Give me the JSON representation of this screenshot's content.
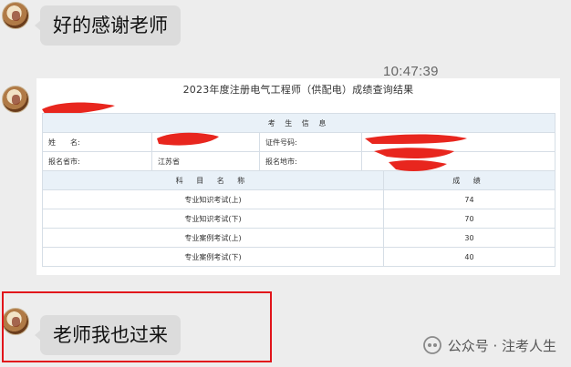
{
  "messages": [
    {
      "text": "好的感谢老师"
    },
    {
      "text": "老师我也过来"
    }
  ],
  "timestamp": "10:47:39",
  "result": {
    "title": "2023年度注册电气工程师（供配电）成绩查询结果",
    "section_title": "考 生 信 息",
    "name_label": "姓　　名:",
    "id_label": "证件号码:",
    "province_label": "报名省市:",
    "province_value": "江苏省",
    "city_label": "报名地市:",
    "subject_header": "科 目 名 称",
    "score_header": "成 绩",
    "rows": [
      {
        "subject": "专业知识考试(上)",
        "score": "74"
      },
      {
        "subject": "专业知识考试(下)",
        "score": "70"
      },
      {
        "subject": "专业案例考试(上)",
        "score": "30"
      },
      {
        "subject": "专业案例考试(下)",
        "score": "40"
      }
    ]
  },
  "watermark": {
    "text": "公众号 · 注考人生",
    "icon": "wechat-official-account-icon"
  },
  "colors": {
    "highlight_box": "#e1151b",
    "redaction": "#e8261e",
    "bubble": "#dcdcdc",
    "table_header": "#e9f1f8"
  }
}
